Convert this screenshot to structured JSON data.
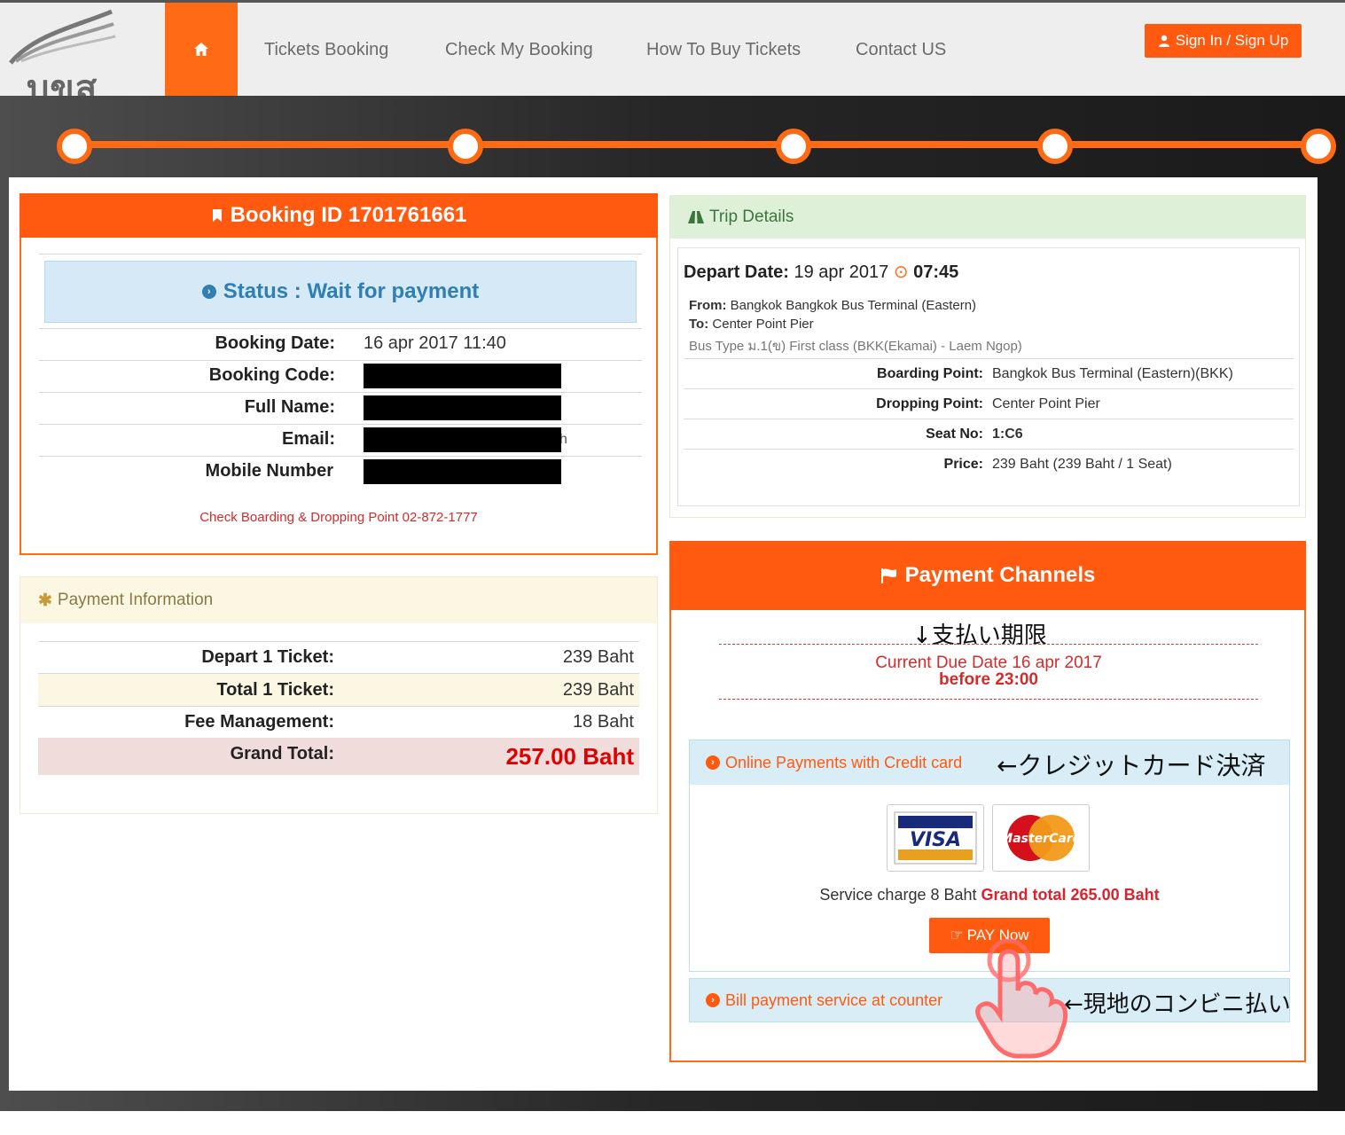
{
  "nav": {
    "logo_text": "บขส",
    "items": [
      "Tickets Booking",
      "Check My Booking",
      "How To Buy Tickets",
      "Contact US"
    ],
    "signin_label": "Sign In / Sign Up"
  },
  "progress": {
    "steps": 5
  },
  "booking": {
    "title": "Booking ID 1701761661",
    "status": "Status : Wait for payment",
    "rows": [
      {
        "label": "Booking Date:",
        "value": "16 apr 2017 11:40"
      },
      {
        "label": "Booking Code:",
        "value": ""
      },
      {
        "label": "Full Name:",
        "value": ""
      },
      {
        "label": "Email:",
        "value": "h"
      },
      {
        "label": "Mobile Number",
        "value": ""
      }
    ],
    "check_link": "Check Boarding & Dropping Point 02-872-1777"
  },
  "payment_info": {
    "title": "Payment Information",
    "rows": [
      {
        "label": "Depart 1 Ticket:",
        "value": "239 Baht"
      },
      {
        "label": "Total 1 Ticket:",
        "value": "239 Baht"
      },
      {
        "label": "Fee Management:",
        "value": "18 Baht"
      },
      {
        "label": "Grand Total:",
        "value": "257.00 Baht"
      }
    ]
  },
  "trip": {
    "title": "Trip Details",
    "depart_label": "Depart Date:",
    "depart_date": "19 apr 2017",
    "depart_time": "07:45",
    "from_label": "From:",
    "from_value": "Bangkok Bangkok Bus Terminal (Eastern)",
    "to_label": "To:",
    "to_value": "Center Point Pier",
    "bus_type": "Bus Type ม.1(ข) First class (BKK(Ekamai) - Laem Ngop)",
    "rows": [
      {
        "label": "Boarding Point:",
        "value": "Bangkok Bus Terminal (Eastern)(BKK)"
      },
      {
        "label": "Dropping Point:",
        "value": "Center Point Pier"
      },
      {
        "label": "Seat No:",
        "value": "1:C6"
      },
      {
        "label": "Price:",
        "value": "239 Baht (239 Baht / 1 Seat)"
      }
    ]
  },
  "channels": {
    "title": "Payment Channels",
    "note_deadline": "↓支払い期限",
    "due_line1": "Current Due Date 16 apr 2017",
    "due_line2": "before 23:00",
    "cc_title": "Online Payments with Credit card",
    "note_cc": "←クレジットカード決済",
    "visa_label": "VISA",
    "mc_label": "MasterCard",
    "service_text": "Service charge 8 Baht",
    "grand_text": "Grand total 265.00 Baht",
    "pay_label": "PAY Now",
    "bill_title": "Bill payment service at counter",
    "note_bill": "←現地のコンビニ払い"
  },
  "colors": {
    "accent": "#ff5a10",
    "info": "#d9edf7",
    "success": "#dff0d8",
    "warning": "#fcf7e3",
    "danger": "#f1dcdc"
  }
}
